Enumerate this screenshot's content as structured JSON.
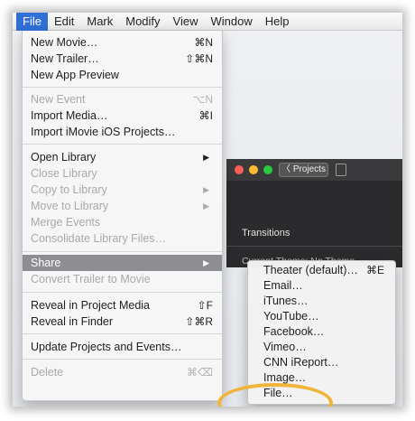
{
  "menubar": {
    "items": [
      "File",
      "Edit",
      "Mark",
      "Modify",
      "View",
      "Window",
      "Help"
    ]
  },
  "file_menu": {
    "new_movie": {
      "label": "New Movie…",
      "shortcut": "⌘N"
    },
    "new_trailer": {
      "label": "New Trailer…",
      "shortcut": "⇧⌘N"
    },
    "new_app_preview": {
      "label": "New App Preview"
    },
    "new_event": {
      "label": "New Event",
      "shortcut": "⌥N"
    },
    "import_media": {
      "label": "Import Media…",
      "shortcut": "⌘I"
    },
    "import_ios": {
      "label": "Import iMovie iOS Projects…"
    },
    "open_library": {
      "label": "Open Library",
      "arrow": "▶"
    },
    "close_library": {
      "label": "Close Library"
    },
    "copy_to_library": {
      "label": "Copy to Library",
      "arrow": "▶"
    },
    "move_to_library": {
      "label": "Move to Library",
      "arrow": "▶"
    },
    "merge_events": {
      "label": "Merge Events"
    },
    "consolidate": {
      "label": "Consolidate Library Files…"
    },
    "share": {
      "label": "Share",
      "arrow": "▶"
    },
    "convert_trailer": {
      "label": "Convert Trailer to Movie"
    },
    "reveal_project_media": {
      "label": "Reveal in Project Media",
      "shortcut": "⇧F"
    },
    "reveal_finder": {
      "label": "Reveal in Finder",
      "shortcut": "⇧⌘R"
    },
    "update_projects": {
      "label": "Update Projects and Events…"
    },
    "delete": {
      "label": "Delete",
      "shortcut": "⌘⌫"
    }
  },
  "share_menu": {
    "theater": {
      "label": "Theater (default)…",
      "shortcut": "⌘E"
    },
    "email": {
      "label": "Email…"
    },
    "itunes": {
      "label": "iTunes…"
    },
    "youtube": {
      "label": "YouTube…"
    },
    "facebook": {
      "label": "Facebook…"
    },
    "vimeo": {
      "label": "Vimeo…"
    },
    "cnn": {
      "label": "CNN iReport…"
    },
    "image": {
      "label": "Image…"
    },
    "file": {
      "label": "File…"
    }
  },
  "imovie_window": {
    "projects_button": "〈 Projects",
    "transitions_label": "Transitions",
    "theme_label": "Current Theme: No Theme"
  },
  "colors": {
    "selection_blue": "#2f6fd6",
    "menu_highlight": "#8d8d92",
    "annotation_ring": "#f0b43a",
    "close_light": "#fc5f57",
    "minimize_light": "#fdbc2e",
    "zoom_light": "#28c840"
  }
}
